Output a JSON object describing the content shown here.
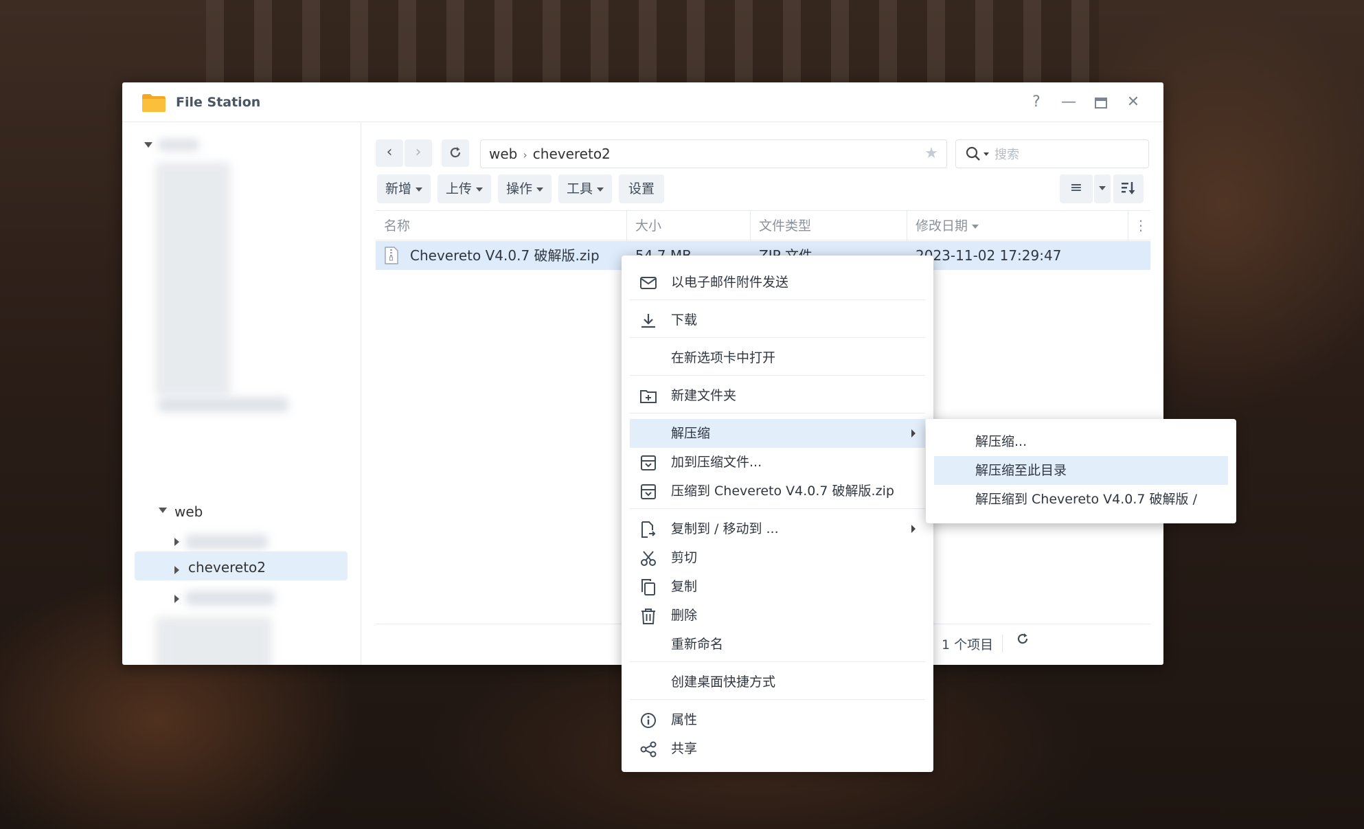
{
  "window": {
    "title": "File Station",
    "controls": {
      "help": "?",
      "minimize": "—",
      "maximize": "☐",
      "close": "✕"
    }
  },
  "sidebar": {
    "items": [
      {
        "label": "web",
        "expanded": true
      },
      {
        "label": "chevereto2",
        "selected": true
      }
    ]
  },
  "toolbar": {
    "path": [
      "web",
      "chevereto2"
    ],
    "search_placeholder": "搜索",
    "buttons": [
      "新增",
      "上传",
      "操作",
      "工具",
      "设置"
    ]
  },
  "table": {
    "columns": [
      "名称",
      "大小",
      "文件类型",
      "修改日期"
    ],
    "rows": [
      {
        "name": "Chevereto V4.0.7 破解版.zip",
        "size": "54.7 MB",
        "type": "ZIP 文件",
        "modified": "2023-11-02 17:29:47"
      }
    ]
  },
  "footer": {
    "item_count": "1 个项目"
  },
  "context_menu": {
    "items": [
      {
        "label": "以电子邮件附件发送",
        "icon": "mail-icon"
      },
      {
        "label": "下载",
        "icon": "download-icon"
      },
      {
        "label": "在新选项卡中打开",
        "icon": ""
      },
      {
        "label": "新建文件夹",
        "icon": "new-folder-icon"
      },
      {
        "label": "解压缩",
        "icon": "",
        "submenu": true,
        "highlighted": true
      },
      {
        "label": "加到压缩文件...",
        "icon": "archive-icon"
      },
      {
        "label": "压缩到 Chevereto V4.0.7 破解版.zip",
        "icon": "archive-icon"
      },
      {
        "label": "复制到 / 移动到 ...",
        "icon": "copy-move-icon",
        "submenu": true
      },
      {
        "label": "剪切",
        "icon": "scissors-icon"
      },
      {
        "label": "复制",
        "icon": "copy-icon"
      },
      {
        "label": "删除",
        "icon": "trash-icon"
      },
      {
        "label": "重新命名",
        "icon": ""
      },
      {
        "label": "创建桌面快捷方式",
        "icon": ""
      },
      {
        "label": "属性",
        "icon": "info-icon"
      },
      {
        "label": "共享",
        "icon": "share-icon"
      }
    ]
  },
  "submenu": {
    "items": [
      {
        "label": "解压缩..."
      },
      {
        "label": "解压缩至此目录",
        "highlighted": true
      },
      {
        "label": "解压缩到 Chevereto V4.0.7 破解版 /"
      }
    ]
  },
  "colors": {
    "accent": "#e3eefb",
    "row_selected": "#deebfa",
    "folder": "#f5a623"
  }
}
